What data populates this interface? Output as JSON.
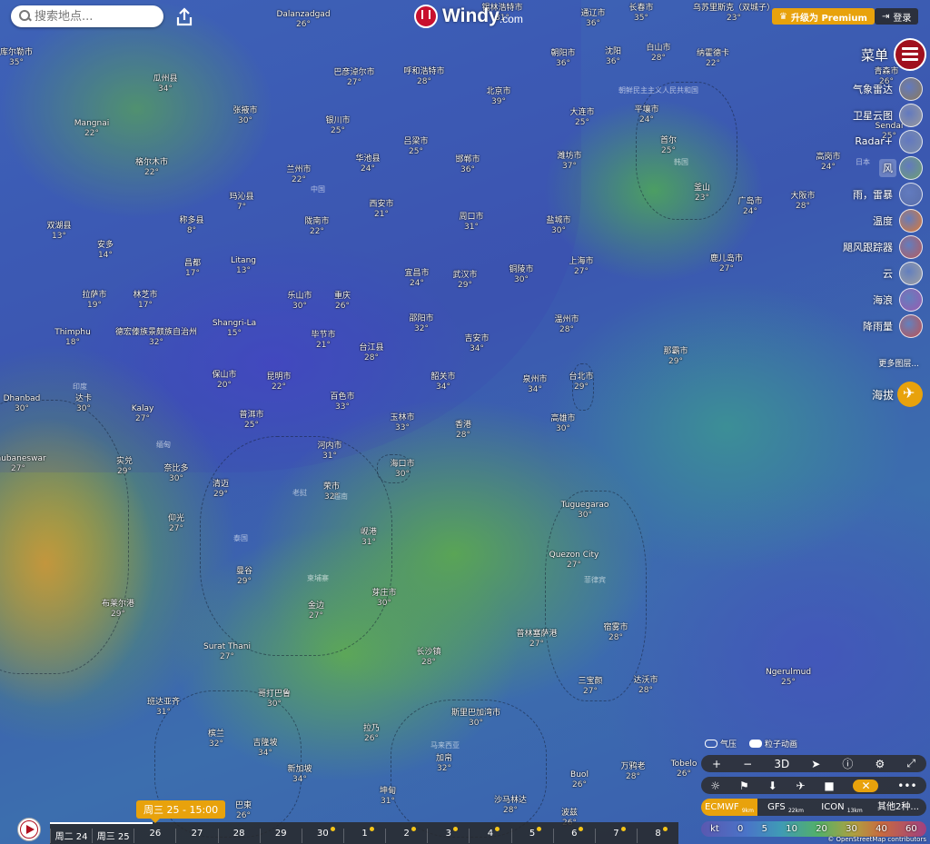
{
  "search": {
    "placeholder": "搜索地点..."
  },
  "logo": {
    "name": "Windy",
    "domain": ".com"
  },
  "header": {
    "premium_label": "升级为 Premium",
    "login_label": "登录"
  },
  "menu": {
    "label": "菜单"
  },
  "layers": [
    {
      "label": "气象雷达",
      "color": "#8c7a5a"
    },
    {
      "label": "卫星云图",
      "color": "#9a9a9a"
    },
    {
      "label": "Radar+",
      "color": "#7e8ea8"
    },
    {
      "label": "风",
      "color": "#6ea070"
    },
    {
      "label": "雨，雷暴",
      "color": "#5a6ea8"
    },
    {
      "label": "温度",
      "color": "#e07830"
    },
    {
      "label": "飓风跟踪器",
      "color": "#b85a5a"
    },
    {
      "label": "云",
      "color": "#a0a0a0"
    },
    {
      "label": "海浪",
      "color": "#9a5ab0"
    },
    {
      "label": "降雨量",
      "color": "#c05050"
    }
  ],
  "more_layers": "更多图层...",
  "altitude": {
    "label": "海拔"
  },
  "toggles": {
    "pressure": "气压",
    "particles": "粒子动画"
  },
  "map_controls": {
    "zoom_in": "+",
    "zoom_out": "−",
    "view3d": "3D"
  },
  "models": [
    {
      "name": "ECMWF",
      "res": "9km"
    },
    {
      "name": "GFS",
      "res": "22km"
    },
    {
      "name": "ICON",
      "res": "13km"
    },
    {
      "name": "其他2种...",
      "res": ""
    }
  ],
  "scale": {
    "unit": "kt",
    "values": [
      "0",
      "5",
      "10",
      "20",
      "30",
      "40",
      "60"
    ]
  },
  "attribution": "© OpenStreetMap contributors",
  "timeline": {
    "current": "周三 25 - 15:00",
    "days": [
      "周二 24",
      "周三 25",
      "26",
      "27",
      "28",
      "29",
      "30",
      "1",
      "2",
      "3",
      "4",
      "5",
      "6",
      "7",
      "8"
    ]
  },
  "countries": [
    "中国",
    "缅甸",
    "老挝",
    "泰国",
    "柬埔寨",
    "越南",
    "菲律宾",
    "韩国",
    "日本",
    "朝鲜民主主义人民共和国",
    "印度",
    "马来西亚"
  ],
  "cities": [
    {
      "name": "库尔勒市",
      "t": "35°"
    },
    {
      "name": "Dalanzadgad",
      "t": "26°"
    },
    {
      "name": "锡林浩特市",
      "t": "31°"
    },
    {
      "name": "通辽市",
      "t": "36°"
    },
    {
      "name": "长春市",
      "t": "35°"
    },
    {
      "name": "乌苏里斯克（双城子）",
      "t": "23°"
    },
    {
      "name": "瓜州县",
      "t": "34°"
    },
    {
      "name": "巴彦淖尔市",
      "t": "27°"
    },
    {
      "name": "呼和浩特市",
      "t": "28°"
    },
    {
      "name": "朝阳市",
      "t": "36°"
    },
    {
      "name": "沈阳",
      "t": "36°"
    },
    {
      "name": "白山市",
      "t": "28°"
    },
    {
      "name": "纳霍德卡",
      "t": "22°"
    },
    {
      "name": "青森市",
      "t": "26°"
    },
    {
      "name": "Mangnai",
      "t": "22°"
    },
    {
      "name": "张掖市",
      "t": "30°"
    },
    {
      "name": "银川市",
      "t": "25°"
    },
    {
      "name": "北京市",
      "t": "39°"
    },
    {
      "name": "大连市",
      "t": "25°"
    },
    {
      "name": "平壤市",
      "t": "24°"
    },
    {
      "name": "Sendai",
      "t": "25°"
    },
    {
      "name": "格尔木市",
      "t": "22°"
    },
    {
      "name": "兰州市",
      "t": "22°"
    },
    {
      "name": "吕梁市",
      "t": "25°"
    },
    {
      "name": "华池县",
      "t": "24°"
    },
    {
      "name": "邯郸市",
      "t": "36°"
    },
    {
      "name": "潍坊市",
      "t": "37°"
    },
    {
      "name": "首尔",
      "t": "25°"
    },
    {
      "name": "高岗市",
      "t": "24°"
    },
    {
      "name": "玛沁县",
      "t": "7°"
    },
    {
      "name": "西安市",
      "t": "21°"
    },
    {
      "name": "周口市",
      "t": "31°"
    },
    {
      "name": "釜山",
      "t": "23°"
    },
    {
      "name": "广岛市",
      "t": "24°"
    },
    {
      "name": "大阪市",
      "t": "28°"
    },
    {
      "name": "双湖县",
      "t": "13°"
    },
    {
      "name": "称多县",
      "t": "8°"
    },
    {
      "name": "陇南市",
      "t": "22°"
    },
    {
      "name": "盐城市",
      "t": "30°"
    },
    {
      "name": "安多",
      "t": "14°"
    },
    {
      "name": "宜昌市",
      "t": "24°"
    },
    {
      "name": "武汉市",
      "t": "29°"
    },
    {
      "name": "铜陵市",
      "t": "30°"
    },
    {
      "name": "上海市",
      "t": "27°"
    },
    {
      "name": "鹿儿岛市",
      "t": "27°"
    },
    {
      "name": "昌都",
      "t": "17°"
    },
    {
      "name": "Litang",
      "t": "13°"
    },
    {
      "name": "乐山市",
      "t": "30°"
    },
    {
      "name": "重庆",
      "t": "26°"
    },
    {
      "name": "拉萨市",
      "t": "19°"
    },
    {
      "name": "林芝市",
      "t": "17°"
    },
    {
      "name": "Shangri-La",
      "t": "15°"
    },
    {
      "name": "毕节市",
      "t": "21°"
    },
    {
      "name": "邵阳市",
      "t": "32°"
    },
    {
      "name": "吉安市",
      "t": "34°"
    },
    {
      "name": "温州市",
      "t": "28°"
    },
    {
      "name": "Thimphu",
      "t": "18°"
    },
    {
      "name": "德宏傣族景颇族自治州",
      "t": "32°"
    },
    {
      "name": "台江县",
      "t": "28°"
    },
    {
      "name": "那霸市",
      "t": "29°"
    },
    {
      "name": "保山市",
      "t": "20°"
    },
    {
      "name": "昆明市",
      "t": "22°"
    },
    {
      "name": "韶关市",
      "t": "34°"
    },
    {
      "name": "泉州市",
      "t": "34°"
    },
    {
      "name": "台北市",
      "t": "29°"
    },
    {
      "name": "Dhanbad",
      "t": "30°"
    },
    {
      "name": "达卡",
      "t": "30°"
    },
    {
      "name": "Kalay",
      "t": "27°"
    },
    {
      "name": "百色市",
      "t": "33°"
    },
    {
      "name": "普洱市",
      "t": "25°"
    },
    {
      "name": "玉林市",
      "t": "33°"
    },
    {
      "name": "香港",
      "t": "28°"
    },
    {
      "name": "高雄市",
      "t": "30°"
    },
    {
      "name": "河内市",
      "t": "31°"
    },
    {
      "name": "海口市",
      "t": "30°"
    },
    {
      "name": "Bhubaneswar",
      "t": "27°"
    },
    {
      "name": "实兑",
      "t": "29°"
    },
    {
      "name": "奈比多",
      "t": "30°"
    },
    {
      "name": "清迈",
      "t": "29°"
    },
    {
      "name": "荣市",
      "t": "32°"
    },
    {
      "name": "Tuguegarao",
      "t": "30°"
    },
    {
      "name": "仰光",
      "t": "27°"
    },
    {
      "name": "岘港",
      "t": "31°"
    },
    {
      "name": "曼谷",
      "t": "29°"
    },
    {
      "name": "Quezon City",
      "t": "27°"
    },
    {
      "name": "金边",
      "t": "27°"
    },
    {
      "name": "芽庄市",
      "t": "30°"
    },
    {
      "name": "布莱尔港",
      "t": "29°"
    },
    {
      "name": "宿雾市",
      "t": "28°"
    },
    {
      "name": "长沙镇",
      "t": "28°"
    },
    {
      "name": "普林塞萨港",
      "t": "27°"
    },
    {
      "name": "Surat Thani",
      "t": "27°"
    },
    {
      "name": "达沃市",
      "t": "28°"
    },
    {
      "name": "Ngerulmud",
      "t": "25°"
    },
    {
      "name": "哥打巴鲁",
      "t": "30°"
    },
    {
      "name": "三宝颜",
      "t": "27°"
    },
    {
      "name": "班达亚齐",
      "t": "31°"
    },
    {
      "name": "斯里巴加湾市",
      "t": "30°"
    },
    {
      "name": "槟兰",
      "t": "32°"
    },
    {
      "name": "吉隆坡",
      "t": "34°"
    },
    {
      "name": "拉乃",
      "t": "26°"
    },
    {
      "name": "加帛",
      "t": "32°"
    },
    {
      "name": "万鸦老",
      "t": "28°"
    },
    {
      "name": "Tobelo",
      "t": "26°"
    },
    {
      "name": "新加坡",
      "t": "34°"
    },
    {
      "name": "Buol",
      "t": "26°"
    },
    {
      "name": "坤甸",
      "t": "31°"
    },
    {
      "name": "巴東",
      "t": "26°"
    },
    {
      "name": "沙马林达",
      "t": "28°"
    },
    {
      "name": "波兹",
      "t": "26°"
    }
  ]
}
